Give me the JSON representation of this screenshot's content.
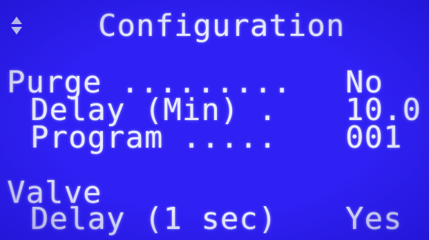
{
  "screen": {
    "title": "Configuration",
    "scroll_icon": "up-down-arrows-icon"
  },
  "purge": {
    "label": "Purge .........",
    "value": "No"
  },
  "delay_min": {
    "label": "Delay (Min) .",
    "value": "10.0"
  },
  "program": {
    "label": "Program .....",
    "value": "001"
  },
  "valve": {
    "label": "Valve"
  },
  "valve_delay": {
    "label": "Delay (1 sec)",
    "value": "Yes"
  },
  "colors": {
    "background": "#2f20f4",
    "text": "#e9ecff"
  }
}
